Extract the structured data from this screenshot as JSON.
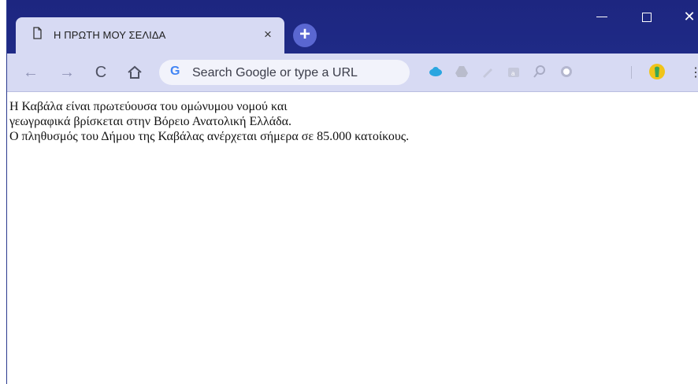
{
  "tab": {
    "title": "Η ΠΡΩΤΗ ΜΟΥ ΣΕΛΙΔΑ",
    "close_glyph": "×",
    "new_tab_glyph": "+"
  },
  "window_controls": {
    "close_glyph": "✕"
  },
  "toolbar": {
    "back_glyph": "←",
    "forward_glyph": "→",
    "reload_glyph": "C",
    "omnibox_placeholder": "Search Google or type a URL",
    "google_logo": "G",
    "menu_glyph": "⋮"
  },
  "icons": {
    "page": "page-icon",
    "home": "home-icon",
    "extensions": [
      "cloud-icon",
      "drive-icon",
      "pen-icon",
      "shopping-icon",
      "magnifier-icon",
      "circle-icon",
      "profile-icon"
    ]
  },
  "colors": {
    "titlebar": "#1d2680",
    "tab_active": "#d7daf3",
    "new_tab_button": "#5a67d1",
    "google_blue": "#4285f4"
  },
  "page": {
    "line1": "Η Καβάλα είναι πρωτεύουσα του ομώνυμου νομού και",
    "line2": "γεωγραφικά βρίσκεται στην Βόρειο Ανατολική Ελλάδα.",
    "line3": "Ο πληθυσμός του Δήμου της Καβάλας ανέρχεται σήμερα σε 85.000 κατοίκους."
  }
}
